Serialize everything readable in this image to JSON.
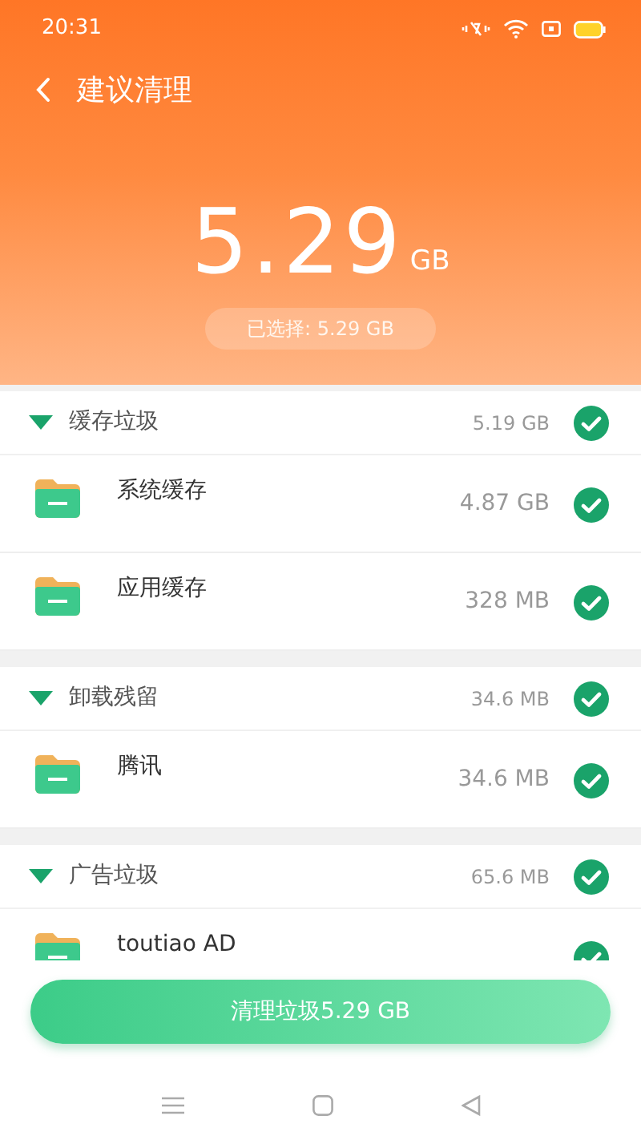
{
  "status_bar": {
    "time": "20:31"
  },
  "header": {
    "title": "建议清理",
    "amount": "5.29",
    "unit": "GB",
    "selected_label": "已选择: 5.29 GB"
  },
  "groups": [
    {
      "name": "缓存垃圾",
      "size": "5.19 GB",
      "checked": true,
      "expanded": true,
      "items": [
        {
          "name": "系统缓存",
          "size": "4.87 GB",
          "checked": true
        },
        {
          "name": "应用缓存",
          "size": "328 MB",
          "checked": true
        }
      ]
    },
    {
      "name": "卸载残留",
      "size": "34.6 MB",
      "checked": true,
      "expanded": true,
      "items": [
        {
          "name": "腾讯",
          "size": "34.6 MB",
          "checked": true
        }
      ]
    },
    {
      "name": "广告垃圾",
      "size": "65.6 MB",
      "checked": true,
      "expanded": true,
      "items": [
        {
          "name": "toutiao AD",
          "checked": true
        }
      ]
    }
  ],
  "clean_button": {
    "label": "清理垃圾5.29 GB"
  }
}
